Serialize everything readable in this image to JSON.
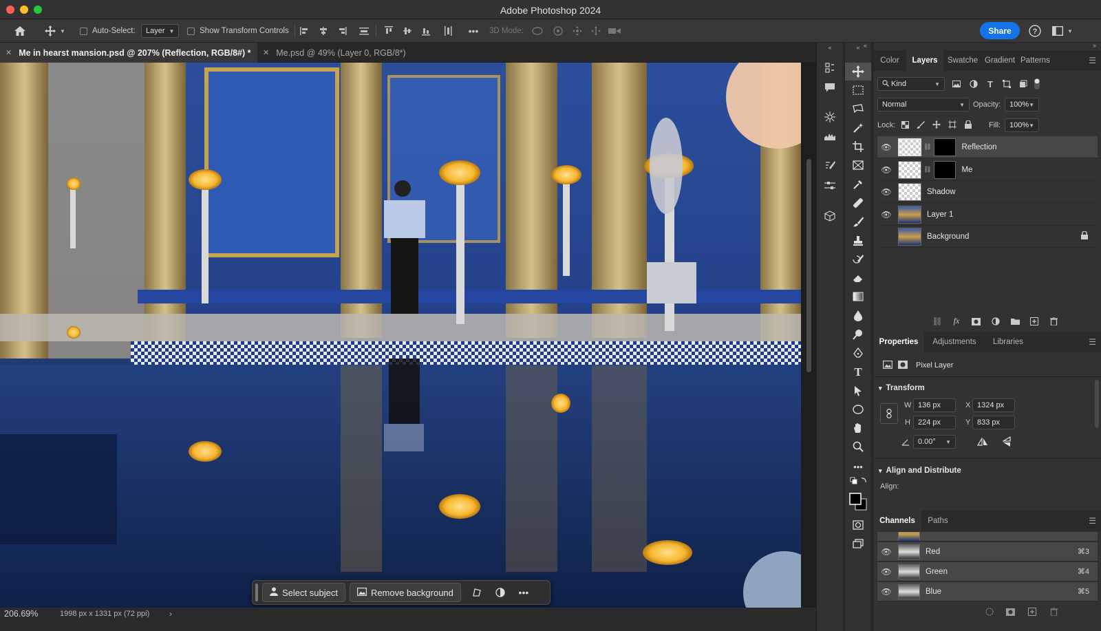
{
  "window": {
    "title": "Adobe Photoshop 2024"
  },
  "options_bar": {
    "auto_select_label": "Auto-Select:",
    "auto_select_target": "Layer",
    "show_transform_label": "Show Transform Controls",
    "mode_3d_label": "3D Mode:",
    "share_label": "Share"
  },
  "doc_tabs": [
    {
      "label": "Me in hearst mansion.psd @ 207% (Reflection, RGB/8#) *",
      "active": true
    },
    {
      "label": "Me.psd @ 49% (Layer 0, RGB/8*)",
      "active": false
    }
  ],
  "task_bar": {
    "select_subject": "Select subject",
    "remove_background": "Remove background",
    "more": "•••"
  },
  "status_bar": {
    "zoom": "206.69%",
    "doc_size": "1998 px x 1331 px (72 ppi)",
    "arrow": "›"
  },
  "layers_panel": {
    "tabs": [
      "Color",
      "Layers",
      "Swatche",
      "Gradient",
      "Patterns"
    ],
    "active_tab": "Layers",
    "filter_kind": "Kind",
    "blend_mode": "Normal",
    "opacity_label": "Opacity:",
    "opacity_value": "100%",
    "lock_label": "Lock:",
    "fill_label": "Fill:",
    "fill_value": "100%",
    "layers": [
      {
        "name": "Reflection",
        "visible": true,
        "selected": true,
        "thumb": "checker",
        "mask": true
      },
      {
        "name": "Me",
        "visible": true,
        "selected": false,
        "thumb": "checker",
        "mask": true
      },
      {
        "name": "Shadow",
        "visible": true,
        "selected": false,
        "thumb": "checker",
        "mask": false
      },
      {
        "name": "Layer 1",
        "visible": true,
        "selected": false,
        "thumb": "photo",
        "mask": false
      },
      {
        "name": "Background",
        "visible": false,
        "selected": false,
        "thumb": "photo",
        "mask": false,
        "locked": true
      }
    ]
  },
  "properties_panel": {
    "tabs": [
      "Properties",
      "Adjustments",
      "Libraries"
    ],
    "active_tab": "Properties",
    "layer_type": "Pixel Layer",
    "transform_heading": "Transform",
    "w_label": "W",
    "w_value": "136 px",
    "h_label": "H",
    "h_value": "224 px",
    "x_label": "X",
    "x_value": "1324 px",
    "y_label": "Y",
    "y_value": "833 px",
    "angle_value": "0.00°",
    "align_heading": "Align and Distribute",
    "align_label": "Align:"
  },
  "channels_panel": {
    "tabs": [
      "Channels",
      "Paths"
    ],
    "active_tab": "Channels",
    "channels": [
      {
        "name": "Red",
        "shortcut": "⌘3"
      },
      {
        "name": "Green",
        "shortcut": "⌘4"
      },
      {
        "name": "Blue",
        "shortcut": "⌘5"
      }
    ]
  },
  "colors": {
    "accent": "#1473e6",
    "panel_bg": "#323232",
    "selected_row": "#474747"
  }
}
